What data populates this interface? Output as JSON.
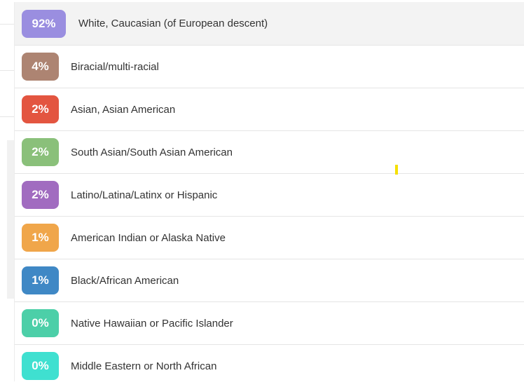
{
  "results": [
    {
      "percent": "92%",
      "label": "White, Caucasian (of European descent)",
      "color": "#9a8ee0"
    },
    {
      "percent": "4%",
      "label": "Biracial/multi-racial",
      "color": "#ad8472"
    },
    {
      "percent": "2%",
      "label": "Asian, Asian American",
      "color": "#e35540"
    },
    {
      "percent": "2%",
      "label": "South Asian/South Asian American",
      "color": "#8ac07a"
    },
    {
      "percent": "2%",
      "label": "Latino/Latina/Latinx or Hispanic",
      "color": "#a16cc0"
    },
    {
      "percent": "1%",
      "label": "American Indian or Alaska Native",
      "color": "#f0a64a"
    },
    {
      "percent": "1%",
      "label": "Black/African American",
      "color": "#3f88c5"
    },
    {
      "percent": "0%",
      "label": "Native Hawaiian or Pacific Islander",
      "color": "#4ccfa8"
    },
    {
      "percent": "0%",
      "label": "Middle Eastern or North African",
      "color": "#3fe0d0"
    }
  ]
}
